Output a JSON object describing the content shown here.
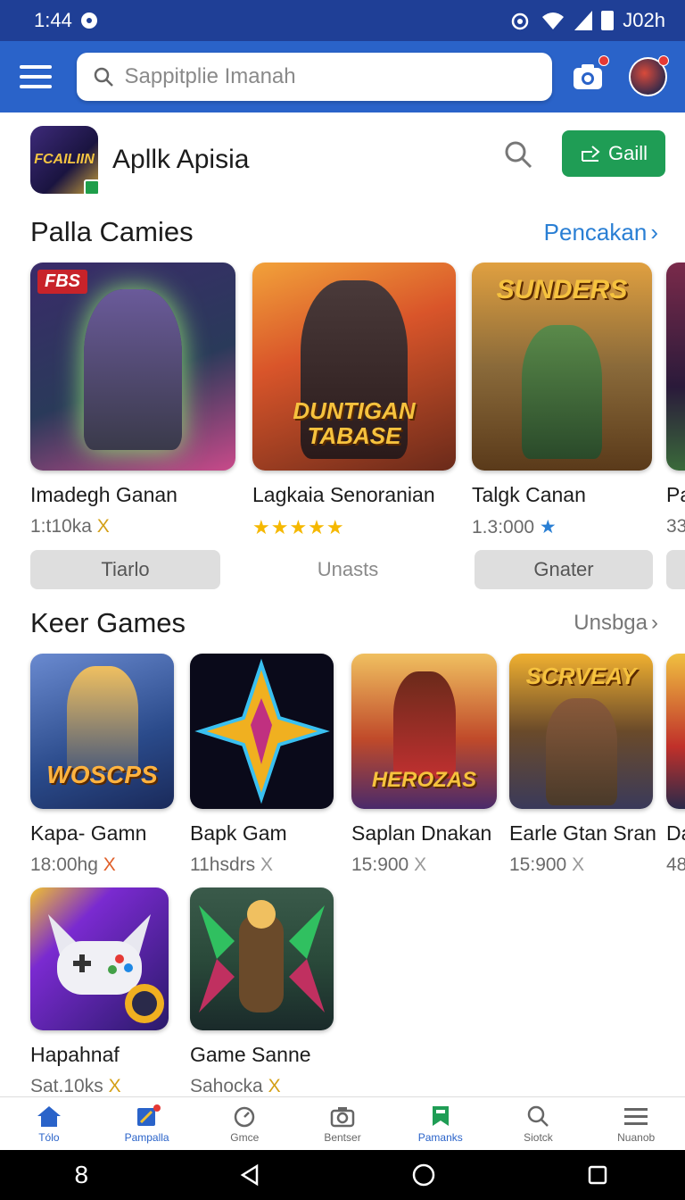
{
  "status": {
    "time": "1:44",
    "right": "J02h"
  },
  "search": {
    "placeholder": "Sappitplie Imanah"
  },
  "featured": {
    "title": "Apllk Apisia",
    "icon_text": "FCAILIIN",
    "get_label": "Gaill"
  },
  "sections": [
    {
      "title": "Palla Camies",
      "link": "Pencakan",
      "items": [
        {
          "title": "Imadegh Ganan",
          "sub": "1:t10ka",
          "sub_mark": "X",
          "button": "Tiarlo",
          "art_text": "FBS",
          "art_colors": [
            "#3a2b6a",
            "#c94a8a",
            "#2a3a5a"
          ]
        },
        {
          "title": "Lagkaia Senoranian",
          "stars": "★★★★★",
          "button": "Unasts",
          "art_text": "DUNTIGAN TABASE",
          "art_colors": [
            "#d9552a",
            "#6a2a1a",
            "#f2a23a"
          ]
        },
        {
          "title": "Talgk Canan",
          "sub": "1.3:000",
          "sub_mark": "★",
          "button": "Gnater",
          "art_text": "SUNDERS",
          "art_colors": [
            "#e0a040",
            "#5a3a1a",
            "#8ac06a"
          ]
        },
        {
          "title": "Pa",
          "sub": "33",
          "button": "",
          "art_text": "",
          "art_colors": [
            "#7a2a4a",
            "#2a1a3a",
            "#3a6a3a"
          ]
        }
      ]
    },
    {
      "title": "Keer Games",
      "link": "Unsbga",
      "items": [
        {
          "title": "Kapa- Gamn",
          "sub": "18:00hg",
          "sub_mark": "X",
          "art_text": "WOSCPS",
          "art_colors": [
            "#2a4a8a",
            "#6a8ad0",
            "#f0a030"
          ]
        },
        {
          "title": "Bapk Gam",
          "sub": "11hsdrs",
          "sub_mark": "X",
          "art_text": "",
          "art_colors": [
            "#0a0a1a",
            "#f0b020",
            "#c03080"
          ]
        },
        {
          "title": "Saplan Dnakan",
          "sub": "15:900",
          "sub_mark": "X",
          "art_text": "HEROZAS",
          "art_colors": [
            "#c04a2a",
            "#f0c060",
            "#4a2a6a"
          ]
        },
        {
          "title": "Earle Gtan Sran",
          "sub": "15:900",
          "sub_mark": "X",
          "art_text": "SCRVEAY",
          "art_colors": [
            "#6a4a2a",
            "#f0b030",
            "#3a3a5a"
          ]
        },
        {
          "title": "Da",
          "sub": "48",
          "sub_mark": "",
          "art_text": "",
          "art_colors": [
            "#c0302a",
            "#f0c040",
            "#2a2a4a"
          ]
        },
        {
          "title": "Hapahnaf",
          "sub": "Sat.10ks",
          "sub_mark": "X",
          "art_text": "",
          "art_colors": [
            "#7a2ad0",
            "#f0c030",
            "#2a1a6a"
          ]
        },
        {
          "title": "Game Sanne",
          "sub": "Sahocka",
          "sub_mark": "X",
          "art_text": "",
          "art_colors": [
            "#2a4a3a",
            "#c03060",
            "#30c060"
          ]
        }
      ]
    }
  ],
  "bottom_nav": [
    {
      "label": "Tólo",
      "icon": "home-icon",
      "active": true
    },
    {
      "label": "Pampalla",
      "icon": "edit-icon",
      "active": true
    },
    {
      "label": "Gmce",
      "icon": "clock-icon",
      "active": false
    },
    {
      "label": "Bentser",
      "icon": "camera-icon",
      "active": false
    },
    {
      "label": "Pamanks",
      "icon": "bookmark-icon",
      "active": true
    },
    {
      "label": "Siotck",
      "icon": "search-icon",
      "active": false
    },
    {
      "label": "Nuanob",
      "icon": "menu-icon",
      "active": false
    }
  ],
  "system_nav": {
    "left": "8"
  },
  "colors": {
    "primary": "#2a63c9",
    "status_bar": "#1f3f96",
    "install": "#1f9d55",
    "link": "#2a7fd4"
  }
}
